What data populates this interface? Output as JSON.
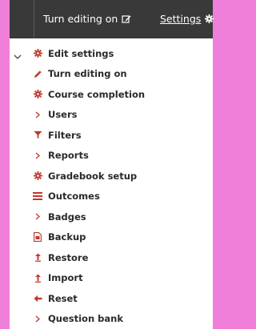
{
  "topbar": {
    "edit_label": "Turn editing on",
    "settings_label": "Settings"
  },
  "menu": {
    "items": [
      {
        "label": "Edit settings",
        "icon": "gear-icon"
      },
      {
        "label": "Turn editing on",
        "icon": "pencil-icon"
      },
      {
        "label": "Course completion",
        "icon": "gear-icon"
      },
      {
        "label": "Users",
        "icon": "chevron-right-icon"
      },
      {
        "label": "Filters",
        "icon": "filter-icon"
      },
      {
        "label": "Reports",
        "icon": "chevron-right-icon"
      },
      {
        "label": "Gradebook setup",
        "icon": "gear-icon"
      },
      {
        "label": "Outcomes",
        "icon": "list-icon"
      },
      {
        "label": "Badges",
        "icon": "chevron-right-icon"
      },
      {
        "label": "Backup",
        "icon": "file-icon"
      },
      {
        "label": "Restore",
        "icon": "upload-icon"
      },
      {
        "label": "Import",
        "icon": "upload-icon"
      },
      {
        "label": "Reset",
        "icon": "arrow-left-icon"
      },
      {
        "label": "Question bank",
        "icon": "chevron-right-icon"
      }
    ]
  },
  "colors": {
    "accent": "#c0392b",
    "topbar_bg": "#393939",
    "page_bg": "#ef7fd9"
  }
}
